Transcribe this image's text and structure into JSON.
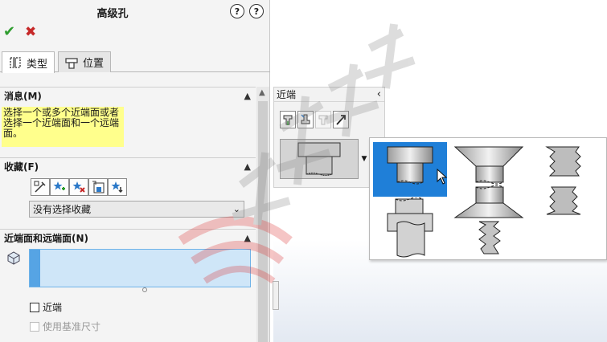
{
  "panel": {
    "title": "高级孔",
    "help_icon_1": "?",
    "help_icon_2": "?",
    "ok": "✔",
    "cancel": "✖"
  },
  "tabs": [
    {
      "label": "类型",
      "active": true
    },
    {
      "label": "位置",
      "active": false
    }
  ],
  "message_section": {
    "title": "消息(M)",
    "text": "选择一个或多个近端面或者选择一个近端面和一个远端面。"
  },
  "favorites_section": {
    "title": "收藏(F)",
    "select_value": "没有选择收藏"
  },
  "faces_section": {
    "title": "近端面和远端面(N)"
  },
  "checkboxes": {
    "near_label": "近端",
    "standard_size_label": "使用基准尺寸"
  },
  "near_panel": {
    "title": "近端",
    "back_icon": "‹"
  },
  "colors": {
    "message_bg": "#ffff8c",
    "selection_blue": "#1f7fd8",
    "list_bg": "#cfe6f8",
    "ok_green": "#2e9d2e",
    "cancel_red": "#c62828"
  },
  "icons": [
    "help-icon",
    "whats-new-icon",
    "ok-icon",
    "cancel-icon",
    "hole-type-icon",
    "position-icon",
    "collapse-icon",
    "face-icon",
    "scroll-up-icon",
    "back-icon",
    "counterbore-icon",
    "countersink-icon",
    "thread-icon",
    "straight-tap-icon"
  ]
}
